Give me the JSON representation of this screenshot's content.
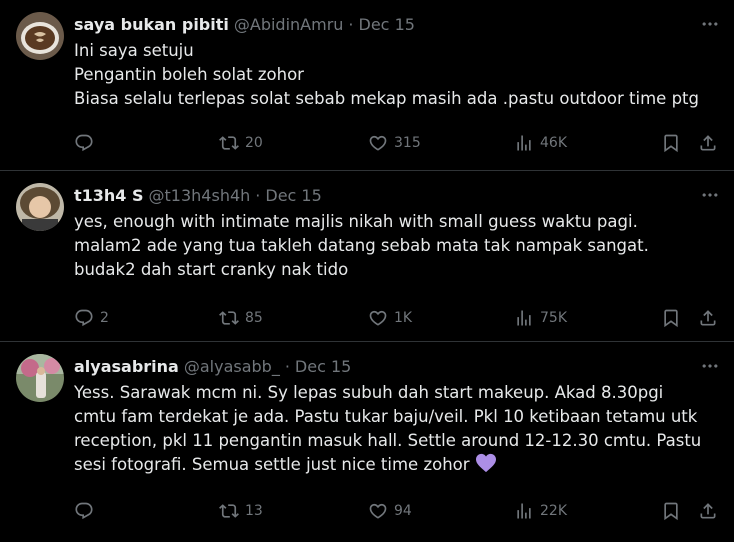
{
  "tweets": [
    {
      "name": "saya bukan pibiti",
      "handle": "@AbidinAmru",
      "sep": "·",
      "date": "Dec 15",
      "lines": [
        "Ini saya setuju",
        "Pengantin boleh solat zohor",
        "Biasa selalu terlepas solat sebab mekap masih ada .pastu outdoor time ptg"
      ],
      "replies": "",
      "reposts": "20",
      "likes": "315",
      "views": "46K"
    },
    {
      "name": "t13h4 S",
      "handle": "@t13h4sh4h",
      "sep": "·",
      "date": "Dec 15",
      "lines": [
        "yes, enough with intimate majlis nikah with small guess waktu pagi.",
        "malam2 ade yang tua takleh datang sebab mata tak nampak sangat.",
        "budak2 dah start cranky nak tido"
      ],
      "replies": "2",
      "reposts": "85",
      "likes": "1K",
      "views": "75K"
    },
    {
      "name": "alyasabrina",
      "handle": "@alyasabb_",
      "sep": "·",
      "date": "Dec 15",
      "lines": [
        "Yess. Sarawak mcm ni. Sy lepas subuh dah start makeup. Akad 8.30pgi",
        "cmtu fam terdekat je ada. Pastu tukar baju/veil. Pkl 10 ketibaan tetamu utk",
        "reception, pkl 11 pengantin masuk hall. Settle around 12-12.30 cmtu. Pastu",
        "sesi fotografi. Semua settle just nice time zohor"
      ],
      "emoji": "purple-heart-icon",
      "replies": "",
      "reposts": "13",
      "likes": "94",
      "views": "22K"
    }
  ],
  "colors": {
    "background": "#000000",
    "text": "#e7e9ea",
    "muted": "#71767b",
    "divider": "#2f3336",
    "heart": "#ac8ee6"
  }
}
